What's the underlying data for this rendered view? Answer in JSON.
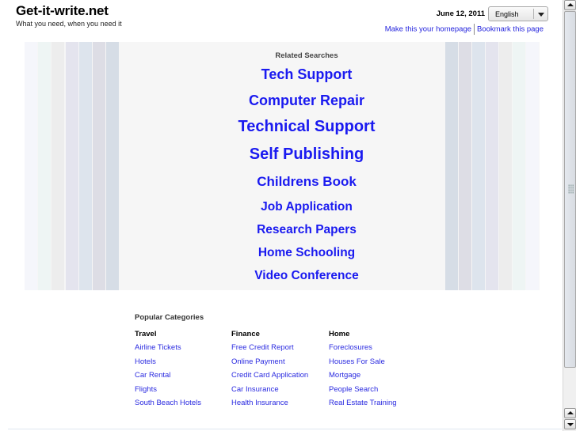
{
  "header": {
    "site_title": "Get-it-write.net",
    "tagline": "What you need, when you need it",
    "date": "June 12, 2011",
    "language_select": {
      "selected": "English"
    },
    "links": [
      {
        "label": "Make this your homepage"
      },
      {
        "label": "Bookmark this page"
      }
    ]
  },
  "related": {
    "title": "Related Searches",
    "links": [
      {
        "label": "Tech Support"
      },
      {
        "label": "Computer Repair"
      },
      {
        "label": "Technical Support"
      },
      {
        "label": "Self Publishing"
      },
      {
        "label": "Childrens Book"
      },
      {
        "label": "Job Application"
      },
      {
        "label": "Research Papers"
      },
      {
        "label": "Home Schooling"
      },
      {
        "label": "Video Conference"
      }
    ],
    "stripe_colors_left": [
      "#f5f6fb",
      "#eef5f4",
      "#ededed",
      "#e4e4ee",
      "#dde4ed",
      "#dddde5",
      "#d6dde6"
    ],
    "stripe_colors_right": [
      "#d6dde6",
      "#dddde5",
      "#dde4ed",
      "#e4e4ee",
      "#ededed",
      "#eef5f4",
      "#f5f6fb"
    ]
  },
  "popular": {
    "title": "Popular Categories",
    "columns": [
      {
        "heading": "Travel",
        "links": [
          "Airline Tickets",
          "Hotels",
          "Car Rental",
          "Flights",
          "South Beach Hotels"
        ]
      },
      {
        "heading": "Finance",
        "links": [
          "Free Credit Report",
          "Online Payment",
          "Credit Card Application",
          "Car Insurance",
          "Health Insurance"
        ]
      },
      {
        "heading": "Home",
        "links": [
          "Foreclosures",
          "Houses For Sale",
          "Mortgage",
          "People Search",
          "Real Estate Training"
        ]
      }
    ]
  },
  "colors": {
    "link": "#1a1af0",
    "panel_bg": "#f6f6f6"
  }
}
